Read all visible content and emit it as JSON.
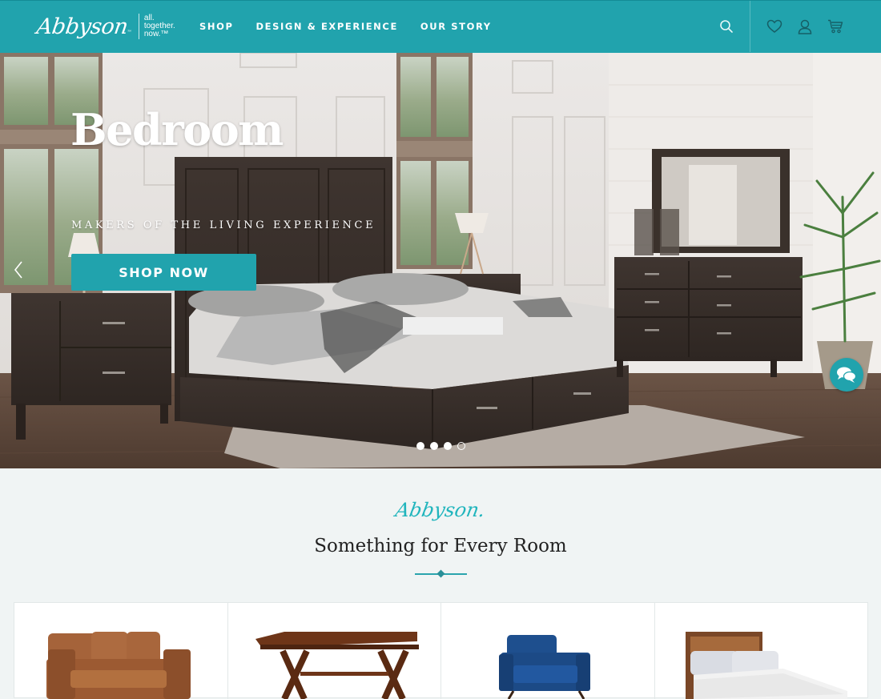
{
  "header": {
    "logo_text": "Abbyson",
    "tagline": [
      "all.",
      "together.",
      "now.™"
    ],
    "nav": [
      {
        "label": "SHOP"
      },
      {
        "label": "DESIGN & EXPERIENCE"
      },
      {
        "label": "OUR STORY"
      }
    ],
    "icons": {
      "search": "search-icon",
      "wishlist": "heart-icon",
      "account": "user-icon",
      "cart": "cart-icon"
    }
  },
  "hero": {
    "title": "Bedroom",
    "subtitle": "MAKERS OF THE LIVING EXPERIENCE",
    "cta_label": "SHOP NOW",
    "slides_total": 4,
    "active_slide": 4,
    "prev_icon": "chevron-left-icon",
    "chat_icon": "chat-bubbles-icon"
  },
  "section": {
    "logo_text": "Abbyson.",
    "title": "Something for Every Room",
    "categories": [
      {
        "name": "sofa",
        "image": "leather-sofa"
      },
      {
        "name": "dining-table",
        "image": "trestle-dining-table"
      },
      {
        "name": "chair",
        "image": "blue-accent-chair"
      },
      {
        "name": "bed",
        "image": "wood-headboard-bed"
      }
    ]
  },
  "colors": {
    "brand_teal": "#21a3ad",
    "background": "#f0f4f4",
    "heading": "#222222"
  }
}
